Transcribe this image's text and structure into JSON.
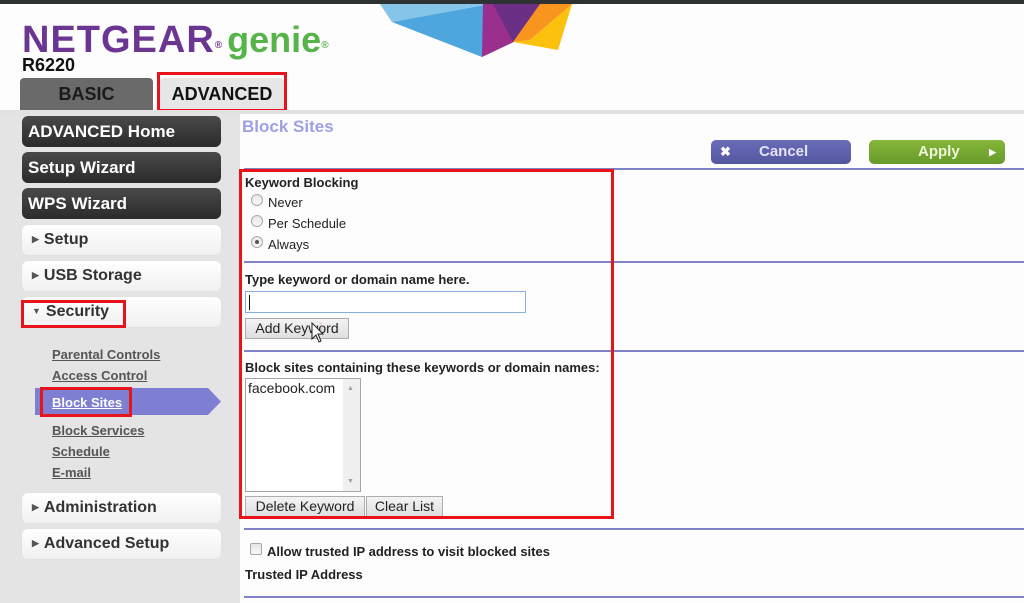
{
  "brand": {
    "name": "NETGEAR",
    "product": "genie",
    "registered_mark": "®",
    "model": "R6220",
    "colors": {
      "netgear_purple": "#6b3592",
      "genie_green": "#57b44a"
    }
  },
  "tabs": [
    {
      "label": "BASIC",
      "active": false
    },
    {
      "label": "ADVANCED",
      "active": true
    }
  ],
  "sidebar": {
    "primary": [
      {
        "label": "ADVANCED Home"
      },
      {
        "label": "Setup Wizard"
      },
      {
        "label": "WPS Wizard"
      }
    ],
    "sections": [
      {
        "label": "Setup",
        "expanded": false
      },
      {
        "label": "USB Storage",
        "expanded": false
      },
      {
        "label": "Security",
        "expanded": true
      },
      {
        "label": "Administration",
        "expanded": false
      },
      {
        "label": "Advanced Setup",
        "expanded": false
      }
    ],
    "security_items": [
      {
        "label": "Parental Controls"
      },
      {
        "label": "Access Control"
      },
      {
        "label": "Block Sites",
        "active": true
      },
      {
        "label": "Block Services"
      },
      {
        "label": "Schedule"
      },
      {
        "label": "E-mail"
      }
    ],
    "colors": {
      "active_item_bg": "#7e7fd2"
    }
  },
  "page": {
    "title": "Block Sites",
    "cancel_label": "Cancel",
    "apply_label": "Apply",
    "keyword_blocking": {
      "heading": "Keyword Blocking",
      "options": [
        "Never",
        "Per Schedule",
        "Always"
      ],
      "selected": "Always"
    },
    "keyword_input": {
      "label": "Type keyword or domain name here.",
      "value": "",
      "add_label": "Add Keyword"
    },
    "blocked_list": {
      "label": "Block sites containing these keywords or domain names:",
      "items": [
        "facebook.com"
      ],
      "delete_label": "Delete Keyword",
      "clear_label": "Clear List"
    },
    "trusted": {
      "checkbox_label": "Allow trusted IP address to visit blocked sites",
      "checked": false,
      "ip_label": "Trusted IP Address"
    },
    "colors": {
      "title": "#9ea0e3",
      "divider": "#8183c8",
      "cancel_bg": "#5f62ad",
      "apply_bg": "#77a832",
      "highlight": "#e8141c"
    }
  }
}
